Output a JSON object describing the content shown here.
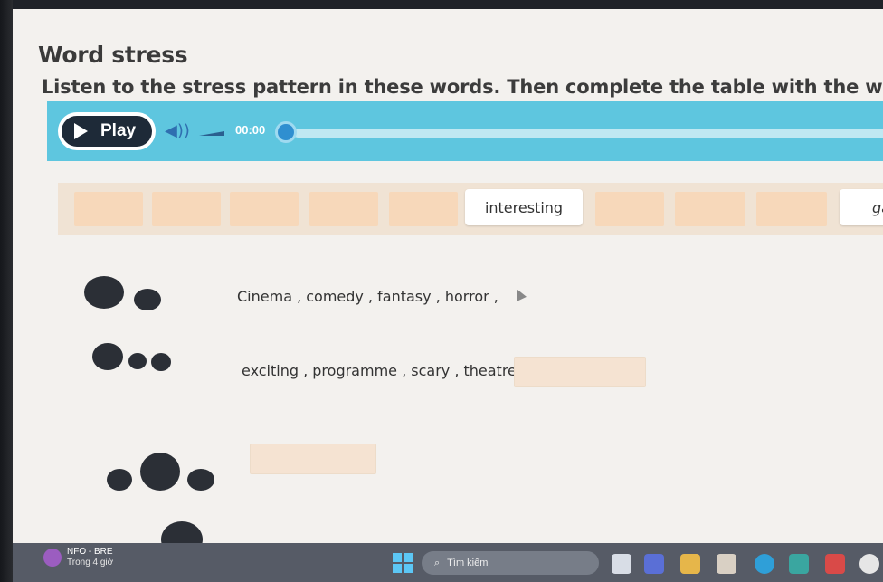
{
  "title": "Word stress",
  "instruction": "Listen to the stress pattern in these words. Then complete the table with the words",
  "player": {
    "play_label": "Play",
    "time": "00:00",
    "volume_icon": "speaker-icon",
    "progress": 0
  },
  "word_bank": {
    "visible_words": [
      "interesting",
      "ga"
    ]
  },
  "rows": [
    {
      "pattern": "Oo",
      "words": "Cinema , comedy , fantasy , horror ,"
    },
    {
      "pattern": "Ooo",
      "words": "exciting , programme , scary , theatre ,"
    },
    {
      "pattern": "oOo",
      "words": ""
    }
  ],
  "taskbar": {
    "app_name": "NFO - BRE",
    "app_sub": "Trong 4 giờ",
    "search_placeholder": "Tìm kiếm"
  },
  "colors": {
    "accent": "#5ec6df",
    "play_button": "#1e2a38",
    "slot": "#f7d8ba",
    "dot": "#2b2f36"
  }
}
